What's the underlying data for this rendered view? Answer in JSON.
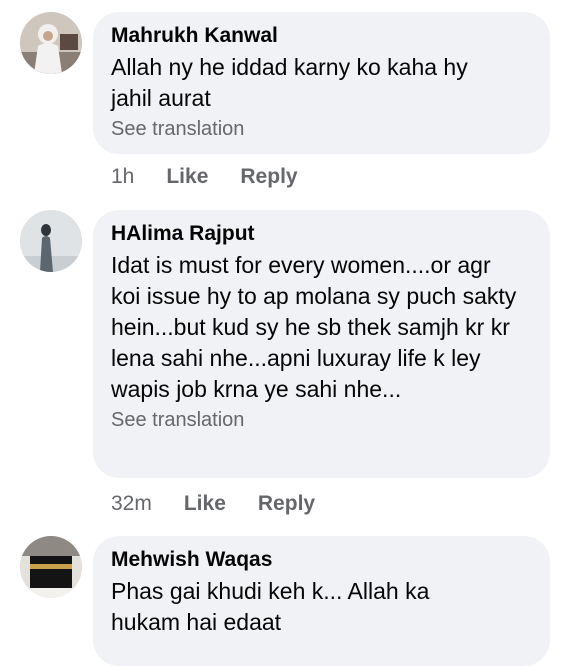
{
  "comments": [
    {
      "author": "Mahrukh Kanwal",
      "text": "Allah ny he iddad karny ko kaha hy jahil aurat",
      "see_translation": "See translation",
      "time": "1h",
      "like": "Like",
      "reply": "Reply"
    },
    {
      "author": "HAlima Rajput",
      "text": "Idat is must for every women....or agr koi issue hy to ap molana sy puch sakty hein...but kud sy he sb thek samjh kr kr lena sahi nhe...apni luxuray life k ley wapis job krna ye sahi nhe...",
      "see_translation": "See translation",
      "time": "32m",
      "like": "Like",
      "reply": "Reply"
    },
    {
      "author": "Mehwish Waqas",
      "text": "Phas gai khudi keh k... Allah ka hukam hai edaat"
    }
  ],
  "colors": {
    "bubble": "#f0f2f5",
    "meta": "#65676b",
    "text": "#050505"
  }
}
